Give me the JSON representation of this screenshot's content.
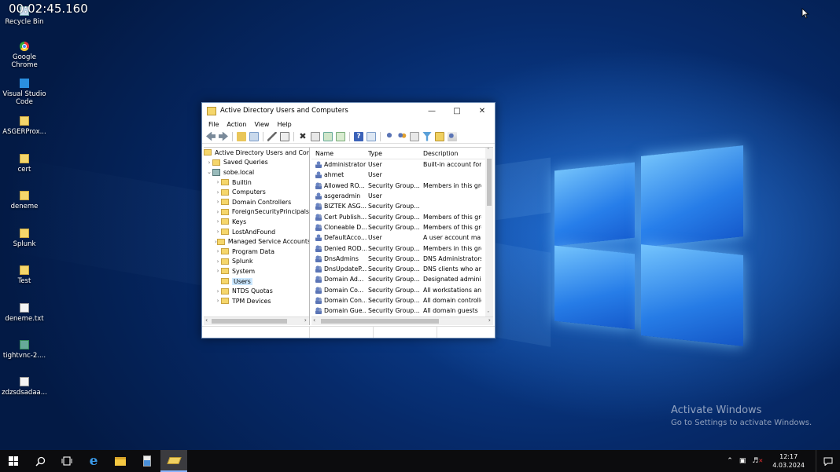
{
  "recording_timer": "00:02:45.160",
  "desktop_icons": [
    {
      "label": "Recycle Bin",
      "icon": "recycle-bin-icon"
    },
    {
      "label": "Google Chrome",
      "icon": "chrome-icon"
    },
    {
      "label": "Visual Studio Code",
      "icon": "vscode-icon"
    },
    {
      "label": "ASGERProx...",
      "icon": "folder-icon"
    },
    {
      "label": "cert",
      "icon": "folder-icon"
    },
    {
      "label": "deneme",
      "icon": "folder-icon"
    },
    {
      "label": "Splunk",
      "icon": "folder-icon"
    },
    {
      "label": "Test",
      "icon": "folder-icon"
    },
    {
      "label": "deneme.txt",
      "icon": "text-file-icon"
    },
    {
      "label": "tightvnc-2....",
      "icon": "installer-icon"
    },
    {
      "label": "zdzsdsadaa...",
      "icon": "file-icon"
    }
  ],
  "window": {
    "title": "Active Directory Users and Computers",
    "menu": [
      "File",
      "Action",
      "View",
      "Help"
    ],
    "tree": {
      "root": "Active Directory Users and Com",
      "saved_queries": "Saved Queries",
      "domain": "sobe.local",
      "children": [
        "Builtin",
        "Computers",
        "Domain Controllers",
        "ForeignSecurityPrincipals",
        "Keys",
        "LostAndFound",
        "Managed Service Accounts",
        "Program Data",
        "Splunk",
        "System",
        "Users",
        "NTDS Quotas",
        "TPM Devices"
      ],
      "selected": "Users"
    },
    "list": {
      "columns": [
        "Name",
        "Type",
        "Description"
      ],
      "rows": [
        {
          "name": "Administrator",
          "type": "User",
          "desc": "Built-in account for",
          "kind": "user"
        },
        {
          "name": "ahmet",
          "type": "User",
          "desc": "",
          "kind": "user"
        },
        {
          "name": "Allowed RO...",
          "type": "Security Group...",
          "desc": "Members in this gro",
          "kind": "group"
        },
        {
          "name": "asgeradmin",
          "type": "User",
          "desc": "",
          "kind": "user"
        },
        {
          "name": "BIZTEK ASG...",
          "type": "Security Group...",
          "desc": "",
          "kind": "group"
        },
        {
          "name": "Cert Publish...",
          "type": "Security Group...",
          "desc": "Members of this gro",
          "kind": "group"
        },
        {
          "name": "Cloneable D...",
          "type": "Security Group...",
          "desc": "Members of this gro",
          "kind": "group"
        },
        {
          "name": "DefaultAcco...",
          "type": "User",
          "desc": "A user account man",
          "kind": "user"
        },
        {
          "name": "Denied ROD...",
          "type": "Security Group...",
          "desc": "Members in this gro",
          "kind": "group"
        },
        {
          "name": "DnsAdmins",
          "type": "Security Group...",
          "desc": "DNS Administrators",
          "kind": "group"
        },
        {
          "name": "DnsUpdateP...",
          "type": "Security Group...",
          "desc": "DNS clients who are",
          "kind": "group"
        },
        {
          "name": "Domain Ad...",
          "type": "Security Group...",
          "desc": "Designated administ",
          "kind": "group"
        },
        {
          "name": "Domain Co...",
          "type": "Security Group...",
          "desc": "All workstations and",
          "kind": "group"
        },
        {
          "name": "Domain Con...",
          "type": "Security Group...",
          "desc": "All domain controlle",
          "kind": "group"
        },
        {
          "name": "Domain Gue...",
          "type": "Security Group...",
          "desc": "All domain guests",
          "kind": "group"
        }
      ]
    }
  },
  "watermark": {
    "line1": "Activate Windows",
    "line2": "Go to Settings to activate Windows."
  },
  "taskbar": {
    "time": "12:17",
    "date": "4.03.2024"
  }
}
